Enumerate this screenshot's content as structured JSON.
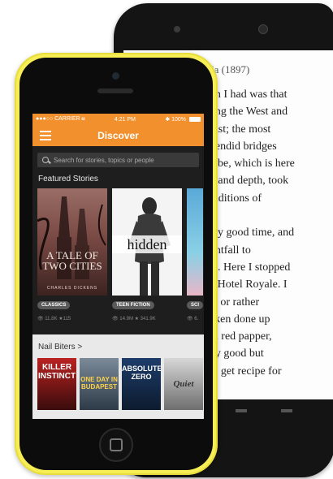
{
  "reader": {
    "header_fragment": "la (1897)",
    "lines": [
      "ion I had was that",
      "ving the West and",
      " East; the most",
      "plendid bridges",
      "nube, which is here",
      "th and depth, took",
      " traditions of",
      "",
      "etty good time, and",
      "ightfall to",
      "gh. Here I stopped",
      " at Hotel Royale. I",
      "er, or rather",
      "icken done up",
      "ith red papper,",
      "ery good but",
      "m. get recipe for"
    ]
  },
  "status_bar": {
    "carrier": "●●●○○ CARRIER ⩏",
    "time": "4:21 PM",
    "battery": "✱ 100%"
  },
  "app_bar": {
    "title": "Discover",
    "menu_icon": "hamburger-icon"
  },
  "search": {
    "placeholder": "Search for stories, topics or people"
  },
  "featured": {
    "title": "Featured Stories",
    "stories": [
      {
        "cover_text": "A TALE OF TWO CITIES",
        "cover_author": "CHARLES DICKENS",
        "tag": "CLASSICS",
        "reads": "👁 11.8K",
        "votes": "★115"
      },
      {
        "cover_text": "hidden",
        "tag": "TEEN FICTION",
        "reads": "👁 14.9M",
        "votes": "★ 341.9K"
      },
      {
        "tag": "SCI",
        "reads": "👁 6."
      }
    ]
  },
  "nail_biters": {
    "title": "Nail Biters >",
    "books": [
      {
        "cover_text": "KILLER INSTINCT"
      },
      {
        "cover_text": "ONE DAY IN BUDAPEST"
      },
      {
        "cover_text": "ABSOLUTE ZERO"
      },
      {
        "cover_text": "Quiet"
      }
    ]
  },
  "colors": {
    "accent_orange": "#f2902e",
    "front_phone_yellow": "#f7ee55",
    "back_phone_black": "#141414"
  }
}
